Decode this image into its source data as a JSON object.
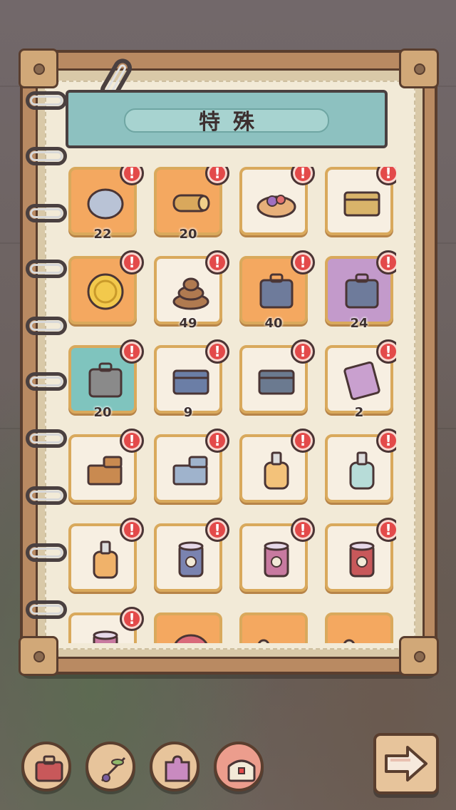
{
  "header": {
    "title": "特殊"
  },
  "items": [
    {
      "name": "fossil-stone-icon",
      "bg": "orange",
      "count": "22",
      "alert": true
    },
    {
      "name": "wood-log-icon",
      "bg": "orange",
      "count": "20",
      "alert": true
    },
    {
      "name": "fruit-tart-icon",
      "bg": "plain",
      "count": "",
      "alert": true
    },
    {
      "name": "cheese-box-icon",
      "bg": "plain",
      "count": "",
      "alert": true
    },
    {
      "name": "gold-coin-icon",
      "bg": "orange",
      "count": "",
      "alert": true
    },
    {
      "name": "poop-icon",
      "bg": "plain",
      "count": "49",
      "alert": true
    },
    {
      "name": "suitcase-orange-icon",
      "bg": "orange",
      "count": "40",
      "alert": true
    },
    {
      "name": "suitcase-purple-icon",
      "bg": "purple",
      "count": "24",
      "alert": true
    },
    {
      "name": "star-suitcase-icon",
      "bg": "teal",
      "count": "20",
      "alert": true
    },
    {
      "name": "storage-chest-icon",
      "bg": "plain",
      "count": "9",
      "alert": true
    },
    {
      "name": "ticket-pouch-icon",
      "bg": "plain",
      "count": "",
      "alert": true
    },
    {
      "name": "condom-packet-icon",
      "bg": "plain",
      "count": "2",
      "alert": true
    },
    {
      "name": "wood-brick-icon",
      "bg": "plain",
      "count": "",
      "alert": true
    },
    {
      "name": "stone-brick-icon",
      "bg": "plain",
      "count": "",
      "alert": true
    },
    {
      "name": "soap-bottle-orange-icon",
      "bg": "plain",
      "count": "",
      "alert": true
    },
    {
      "name": "soap-bottle-blue-icon",
      "bg": "plain",
      "count": "",
      "alert": true
    },
    {
      "name": "bottle-icon",
      "bg": "plain",
      "count": "",
      "alert": true
    },
    {
      "name": "tin-can-skull-icon",
      "bg": "plain",
      "count": "",
      "alert": true
    },
    {
      "name": "tin-can-pink-icon",
      "bg": "plain",
      "count": "",
      "alert": true
    },
    {
      "name": "tin-can-red-icon",
      "bg": "plain",
      "count": "",
      "alert": true
    },
    {
      "name": "tin-can-small-icon",
      "bg": "plain",
      "count": "",
      "alert": true
    },
    {
      "name": "tentacle-icon",
      "bg": "orange",
      "count": "",
      "alert": false
    },
    {
      "name": "bone-icon",
      "bg": "orange",
      "count": "",
      "alert": false
    },
    {
      "name": "bone-icon",
      "bg": "orange",
      "count": "",
      "alert": false
    }
  ],
  "bottom_nav": [
    {
      "name": "bag-tab-button",
      "icon": "briefcase-icon",
      "active": false
    },
    {
      "name": "plant-tab-button",
      "icon": "berry-branch-icon",
      "active": false
    },
    {
      "name": "puzzle-tab-button",
      "icon": "puzzle-icon",
      "active": false
    },
    {
      "name": "chest-tab-button",
      "icon": "treasure-chest-icon",
      "active": true
    }
  ],
  "next_button": {
    "icon": "arrow-right-icon"
  },
  "colors": {
    "accent_red": "#e34a4a",
    "header_teal": "#8dc1c0",
    "tile_orange": "#f4a860",
    "tile_teal": "#7fc4be",
    "tile_purple": "#c39acb"
  }
}
